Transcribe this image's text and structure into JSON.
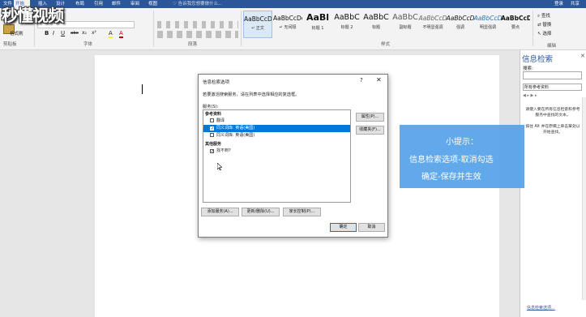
{
  "tabs": [
    "文件",
    "开始",
    "插入",
    "设计",
    "布局",
    "引用",
    "邮件",
    "审阅",
    "视图"
  ],
  "active_tab_index": 1,
  "tell_me": "♡ 告诉我您想要做什么...",
  "account": {
    "login": "登录",
    "share": "共享"
  },
  "logo_text": "秒懂视频",
  "ribbon": {
    "clipboard": {
      "paste": "粘贴",
      "format_painter": "格式刷",
      "label": "剪贴板"
    },
    "font": {
      "label": "字体",
      "bold": "B",
      "italic": "I",
      "underline": "U",
      "strike": "abc",
      "subscript": "x₂",
      "superscript": "x²",
      "font_color": "A",
      "highlight": "A"
    },
    "paragraph": {
      "label": "段落"
    },
    "styles": {
      "label": "样式",
      "items": [
        {
          "sample": "AaBbCcDc",
          "name": "↵ 正文"
        },
        {
          "sample": "AaBbCcDc",
          "name": "↵ 无间隔"
        },
        {
          "sample": "AaBl",
          "name": "标题 1"
        },
        {
          "sample": "AaBbC",
          "name": "标题 2"
        },
        {
          "sample": "AaBbC",
          "name": "标题"
        },
        {
          "sample": "AaBbC",
          "name": "副标题"
        },
        {
          "sample": "AaBbCcD",
          "name": "不明显强调"
        },
        {
          "sample": "AaBbCcD",
          "name": "强调"
        },
        {
          "sample": "AaBbCcD",
          "name": "明显强调"
        },
        {
          "sample": "AaBbCcD",
          "name": "要点"
        }
      ]
    },
    "editing": {
      "find": "查找",
      "replace": "替换",
      "select": "选择",
      "label": "编辑"
    }
  },
  "research_pane": {
    "title": "信息检索",
    "search_label": "搜索:",
    "source": "所有参考资料",
    "message": "请键入要在所有信息检索和参考服务中查找的文本。\n\n按住 Alt 并在原稿上单击某处以开始查找。",
    "footer_link": "信息检索选项..."
  },
  "dialog": {
    "title": "信息检索选项",
    "help": "?",
    "close": "✕",
    "description": "若要激活搜索服务，请在列表中选择相应的复选框。",
    "services_label": "服务(S):",
    "items": [
      {
        "text": "参考资料",
        "kind": "header"
      },
      {
        "text": "翻译",
        "checked": false,
        "selected": false
      },
      {
        "text": "同义词库: 英语(美国)",
        "checked": true,
        "selected": true
      },
      {
        "text": "同义词库: 英语(美国)",
        "checked": false,
        "selected": false
      },
      {
        "text": "其他服务",
        "kind": "header"
      },
      {
        "text": "找不到?",
        "checked": true,
        "selected": false
      }
    ],
    "side_buttons": [
      "属性(P)...",
      "收藏夹(F)..."
    ],
    "bottom_buttons": [
      "添加服务(A)...",
      "更新/删除(U)...",
      "家长控制(P)..."
    ],
    "ok": "确定",
    "cancel": "取消"
  },
  "tip": {
    "title": "小提示：",
    "line1": "信息检索选项-取消勾选",
    "line2": "确定-保存并生效"
  }
}
